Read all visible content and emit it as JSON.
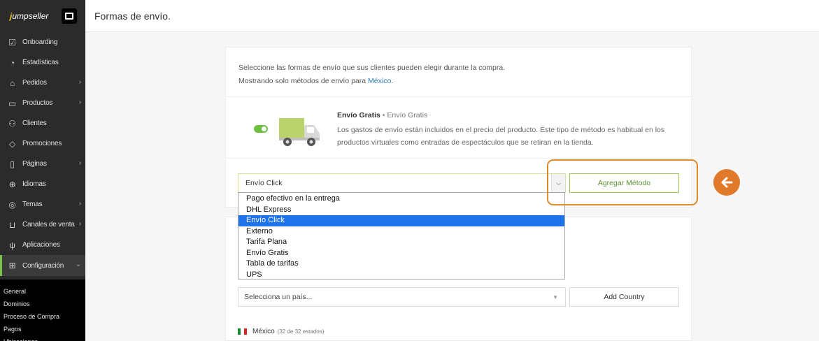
{
  "app": {
    "logo_prefix": "j",
    "logo_rest": "umpseller"
  },
  "header": {
    "title": "Formas de envío."
  },
  "sidebar": {
    "items": [
      {
        "label": "Onboarding",
        "icon": "check-square-icon",
        "chevron": false
      },
      {
        "label": "Estadísticas",
        "icon": "gauge-icon",
        "chevron": false
      },
      {
        "label": "Pedidos",
        "icon": "basket-icon",
        "chevron": true
      },
      {
        "label": "Productos",
        "icon": "box-icon",
        "chevron": true
      },
      {
        "label": "Clientes",
        "icon": "users-icon",
        "chevron": false
      },
      {
        "label": "Promociones",
        "icon": "tag-icon",
        "chevron": false
      },
      {
        "label": "Páginas",
        "icon": "page-icon",
        "chevron": true
      },
      {
        "label": "Idiomas",
        "icon": "globe-icon",
        "chevron": false
      },
      {
        "label": "Temas",
        "icon": "theme-icon",
        "chevron": true
      },
      {
        "label": "Canales de venta",
        "icon": "cart-icon",
        "chevron": true
      },
      {
        "label": "Aplicaciones",
        "icon": "plug-icon",
        "chevron": false
      },
      {
        "label": "Configuración",
        "icon": "settings-icon",
        "chevron": true,
        "active": true
      }
    ],
    "submenu": [
      "General",
      "Dominios",
      "Proceso de Compra",
      "Pagos",
      "Ubicaciones"
    ]
  },
  "main": {
    "intro_line1": "Seleccione las formas de envío que sus clientes pueden elegir durante la compra.",
    "intro_line2_prefix": "Mostrando solo métodos de envío para ",
    "intro_country_link": "México",
    "intro_line2_suffix": ".",
    "method": {
      "name": "Envío Gratis",
      "separator": " • ",
      "type": "Envío Gratis",
      "enabled": true,
      "description": "Los gastos de envío están incluidos en el precio del producto. Este tipo de método es habitual en los productos virtuales como entradas de espectáculos que se retiran en la tienda."
    },
    "method_select": {
      "value": "Envío Click",
      "options": [
        "Pago efectivo en la entrega",
        "DHL Express",
        "Envío Click",
        "Externo",
        "Tarifa Plana",
        "Envío Gratis",
        "Tabla de tarifas",
        "UPS"
      ],
      "selected_index": 2
    },
    "add_method_label": "Agregar Método",
    "country_select_placeholder": "Selecciona un país...",
    "add_country_label": "Add Country",
    "country_row": {
      "name": "México",
      "states": "(32 de 32 estados)"
    }
  },
  "colors": {
    "accent_green": "#6cbf3f",
    "highlight_orange": "#e07a2a",
    "selected_blue": "#1e73e8",
    "sidebar_bg": "#2b2b2b"
  }
}
